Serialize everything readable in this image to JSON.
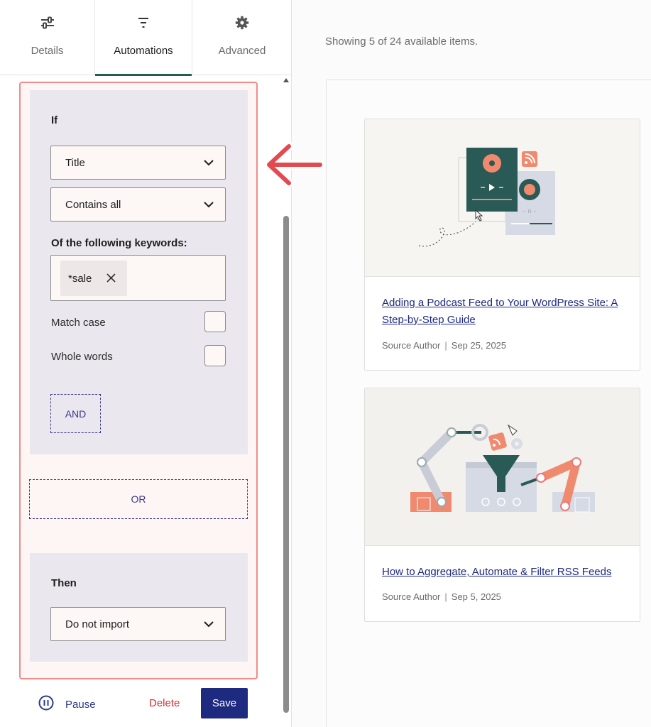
{
  "tabs": [
    {
      "label": "Details",
      "icon": "sliders-icon"
    },
    {
      "label": "Automations",
      "icon": "filter-icon",
      "active": true
    },
    {
      "label": "Advanced",
      "icon": "gear-icon"
    }
  ],
  "rule": {
    "if_heading": "If",
    "field_select": "Title",
    "condition_select": "Contains all",
    "keywords_label": "Of the following keywords:",
    "keywords": [
      "*sale"
    ],
    "match_case_label": "Match case",
    "whole_words_label": "Whole words",
    "and_label": "AND",
    "or_label": "OR",
    "then_heading": "Then",
    "action_select": "Do not import"
  },
  "footer": {
    "pause_label": "Pause",
    "delete_label": "Delete",
    "save_label": "Save"
  },
  "main": {
    "showing_text": "Showing 5 of 24 available items.",
    "items": [
      {
        "title": "Adding a Podcast Feed to Your WordPress Site: A Step-by-Step Guide",
        "author": "Source Author",
        "separator": "|",
        "date": "Sep 25, 2025"
      },
      {
        "title": "How to Aggregate, Automate & Filter RSS Feeds",
        "author": "Source Author",
        "separator": "|",
        "date": "Sep 5, 2025"
      }
    ]
  },
  "colors": {
    "accent_dark_green": "#2a5a55",
    "rule_border": "#f08b8b",
    "primary_blue": "#1d2a80",
    "danger_red": "#d12f2f",
    "illustration_coral": "#f08a6f"
  }
}
